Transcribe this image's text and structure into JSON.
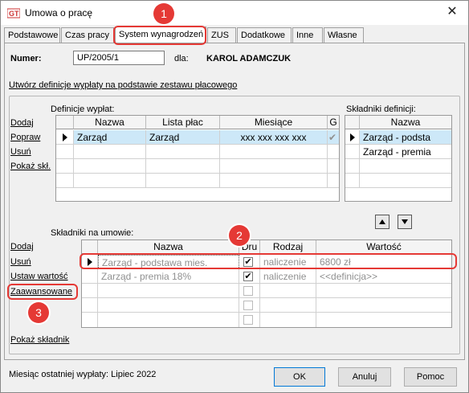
{
  "window": {
    "title": "Umowa o pracę",
    "close_glyph": "✕"
  },
  "tabs": [
    {
      "label": "Podstawowe"
    },
    {
      "label": "Czas pracy"
    },
    {
      "label": "System wynagrodzeń"
    },
    {
      "label": "ZUS"
    },
    {
      "label": "Dodatkowe"
    },
    {
      "label": "Inne"
    },
    {
      "label": "Własne"
    }
  ],
  "header": {
    "number_label": "Numer:",
    "number_value": "UP/2005/1",
    "for_label": "dla:",
    "employee": "KAROL ADAMCZUK"
  },
  "create_link": "Utwórz definicje wypłaty na podstawie zestawu płacowego",
  "definitions": {
    "title": "Definicje wypłat:",
    "actions": [
      "Dodaj",
      "Popraw",
      "Usuń",
      "Pokaż skł."
    ],
    "columns": [
      "Nazwa",
      "Lista płac",
      "Miesiące",
      "G"
    ],
    "rows": [
      {
        "nazwa": "Zarząd",
        "lista": "Zarząd",
        "miesiace": "xxx xxx xxx xxx",
        "g": "✔"
      }
    ]
  },
  "components": {
    "title": "Składniki definicji:",
    "column": "Nazwa",
    "rows": [
      "Zarząd - podsta",
      "Zarząd - premia"
    ]
  },
  "contract": {
    "title": "Składniki na umowie:",
    "actions": [
      "Dodaj",
      "Usuń",
      "Ustaw wartość",
      "Zaawansowane"
    ],
    "show_link": "Pokaż składnik",
    "columns": [
      "Nazwa",
      "Dru",
      "Rodzaj",
      "Wartość"
    ],
    "rows": [
      {
        "nazwa": "Zarząd - podstawa mies.",
        "checked": "✔",
        "rodzaj": "naliczenie",
        "wartosc": "6800 zł"
      },
      {
        "nazwa": "Zarząd - premia 18%",
        "checked": "✔",
        "rodzaj": "naliczenie",
        "wartosc": "<<definicja>>"
      }
    ]
  },
  "footer": {
    "last_payout": "Miesiąc ostatniej wypłaty: Lipiec 2022",
    "ok": "OK",
    "cancel": "Anuluj",
    "help": "Pomoc"
  },
  "callouts": [
    "1",
    "2",
    "3"
  ],
  "colors": {
    "accent": "#e53935",
    "selection": "#cde8f8"
  },
  "icons": [
    "app-logo-icon",
    "close-icon",
    "row-indicator-icon",
    "move-up-icon",
    "move-down-icon",
    "checkbox-icon"
  ]
}
